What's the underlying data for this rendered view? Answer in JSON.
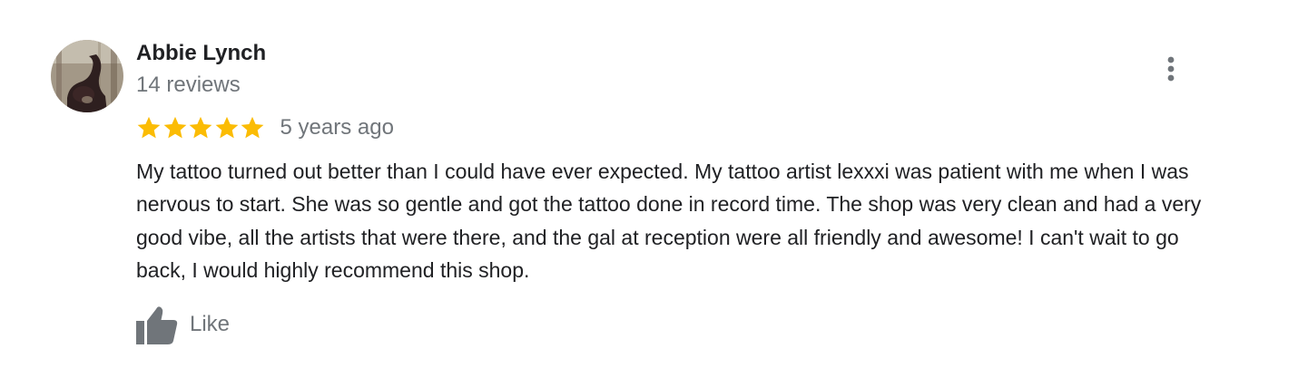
{
  "review": {
    "author_name": "Abbie Lynch",
    "review_count": "14 reviews",
    "rating": 5,
    "max_rating": 5,
    "time_ago": "5 years ago",
    "text": "My tattoo turned out better than I could have ever expected. My tattoo artist lexxxi was patient with me when I was nervous to start. She was so gentle and got the tattoo done in record time. The shop was very clean and had a very good vibe, all the artists that were there, and the gal at reception were all friendly and awesome! I can't wait to go back, I would highly recommend this shop.",
    "like_label": "Like"
  },
  "icons": {
    "more": "more-vertical-icon",
    "star": "star-icon",
    "like": "thumbs-up-icon"
  },
  "colors": {
    "star": "#fbbc04",
    "author_text": "#202124",
    "secondary_text": "#70757a",
    "icon_gray": "#70757a"
  }
}
